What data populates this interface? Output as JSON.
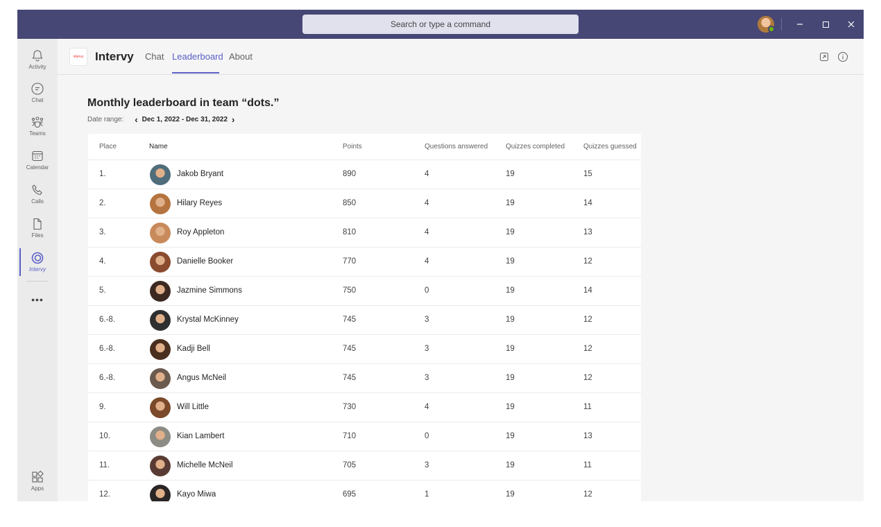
{
  "titlebar": {
    "search_placeholder": "Search or type a command",
    "minimize_icon": "minimize-icon",
    "maximize_icon": "maximize-icon",
    "close_icon": "close-icon",
    "accent_color": "#464775"
  },
  "rail": {
    "items": [
      {
        "label": "Activity",
        "icon": "bell-icon"
      },
      {
        "label": "Chat",
        "icon": "chat-icon"
      },
      {
        "label": "Teams",
        "icon": "teams-icon"
      },
      {
        "label": "Calendar",
        "icon": "calendar-icon"
      },
      {
        "label": "Calls",
        "icon": "phone-icon"
      },
      {
        "label": "Files",
        "icon": "file-icon"
      },
      {
        "label": "Intervy",
        "icon": "intervy-icon",
        "active": true
      }
    ],
    "more": "•••",
    "apps": {
      "label": "Apps",
      "icon": "apps-icon"
    }
  },
  "app": {
    "logo_text": "intervy",
    "name": "Intervy",
    "tabs": [
      {
        "label": "Chat"
      },
      {
        "label": "Leaderboard",
        "active": true
      },
      {
        "label": "About"
      }
    ],
    "accent_color": "#5b5fc7"
  },
  "leaderboard": {
    "title": "Monthly leaderboard in team “dots.”",
    "date_range_label": "Date range:",
    "date_range_value": "Dec 1, 2022 - Dec 31, 2022",
    "columns": [
      "Place",
      "Name",
      "Points",
      "Questions answered",
      "Quizzes completed",
      "Quizzes guessed"
    ],
    "rows": [
      {
        "place": "1.",
        "name": "Jakob Bryant",
        "points": "890",
        "questions": "4",
        "quizzes_completed": "19",
        "quizzes_guessed": "15",
        "avatar_color": "#4f6d7a"
      },
      {
        "place": "2.",
        "name": "Hilary Reyes",
        "points": "850",
        "questions": "4",
        "quizzes_completed": "19",
        "quizzes_guessed": "14",
        "avatar_color": "#b5743f"
      },
      {
        "place": "3.",
        "name": "Roy Appleton",
        "points": "810",
        "questions": "4",
        "quizzes_completed": "19",
        "quizzes_guessed": "13",
        "avatar_color": "#c98a5b"
      },
      {
        "place": "4.",
        "name": "Danielle Booker",
        "points": "770",
        "questions": "4",
        "quizzes_completed": "19",
        "quizzes_guessed": "12",
        "avatar_color": "#8a4b2f"
      },
      {
        "place": "5.",
        "name": "Jazmine Simmons",
        "points": "750",
        "questions": "0",
        "quizzes_completed": "19",
        "quizzes_guessed": "14",
        "avatar_color": "#3c2a22"
      },
      {
        "place": "6.-8.",
        "name": "Krystal McKinney",
        "points": "745",
        "questions": "3",
        "quizzes_completed": "19",
        "quizzes_guessed": "12",
        "avatar_color": "#2f2f2f"
      },
      {
        "place": "6.-8.",
        "name": "Kadji Bell",
        "points": "745",
        "questions": "3",
        "quizzes_completed": "19",
        "quizzes_guessed": "12",
        "avatar_color": "#4a2f1f"
      },
      {
        "place": "6.-8.",
        "name": "Angus McNeil",
        "points": "745",
        "questions": "3",
        "quizzes_completed": "19",
        "quizzes_guessed": "12",
        "avatar_color": "#6b5a4e"
      },
      {
        "place": "9.",
        "name": "Will Little",
        "points": "730",
        "questions": "4",
        "quizzes_completed": "19",
        "quizzes_guessed": "11",
        "avatar_color": "#7a4a2a"
      },
      {
        "place": "10.",
        "name": "Kian Lambert",
        "points": "710",
        "questions": "0",
        "quizzes_completed": "19",
        "quizzes_guessed": "13",
        "avatar_color": "#8c8c84"
      },
      {
        "place": "11.",
        "name": "Michelle McNeil",
        "points": "705",
        "questions": "3",
        "quizzes_completed": "19",
        "quizzes_guessed": "11",
        "avatar_color": "#5a3b33"
      },
      {
        "place": "12.",
        "name": "Kayo Miwa",
        "points": "695",
        "questions": "1",
        "quizzes_completed": "19",
        "quizzes_guessed": "12",
        "avatar_color": "#2b2626"
      }
    ]
  }
}
